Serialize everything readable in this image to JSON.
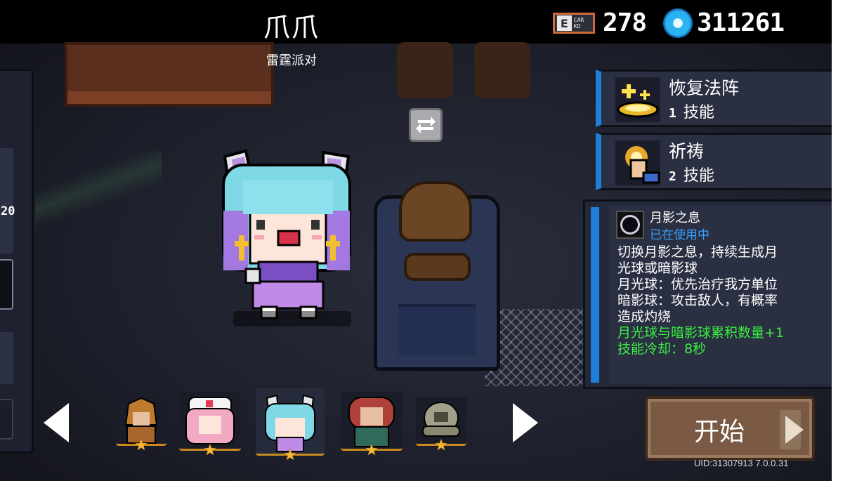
{
  "hero": {
    "name": "爪爪",
    "skin": "雷霆派对"
  },
  "currency": {
    "ecard_icon": "e-card-icon",
    "ecard_small_text": "CAR KD",
    "ecard_count": "278",
    "gem_icon": "blue-gem-icon",
    "gem_count": "311261"
  },
  "left_panel": {
    "partial_value": "20"
  },
  "skills": [
    {
      "icon": "golden-healing-circle-icon",
      "name": "恢复法阵",
      "level": "1",
      "level_label": "技能"
    },
    {
      "icon": "praying-hands-icon",
      "name": "祈祷",
      "level": "2",
      "level_label": "技能"
    }
  ],
  "weapon": {
    "icon": "dark-moon-orb-icon",
    "name": "月影之息",
    "status": "已在使用中",
    "description_lines": [
      "切换月影之息，持续生成月",
      "光球或暗影球",
      "月光球：优先治疗我方单位",
      "暗影球：攻击敌人，有概率",
      "造成灼烧"
    ],
    "bonus_lines": [
      "月光球与暗影球累积数量+1",
      "技能冷却：8秒"
    ]
  },
  "character_selector": {
    "prev_icon": "arrow-left-icon",
    "next_icon": "arrow-right-icon",
    "characters": [
      {
        "id": "char-1",
        "icon": "feathered-priest-portrait",
        "star": "★"
      },
      {
        "id": "char-2",
        "icon": "pink-nurse-portrait",
        "star": "★"
      },
      {
        "id": "char-3",
        "icon": "cyan-cat-girl-portrait",
        "star": "★",
        "selected": true
      },
      {
        "id": "char-4",
        "icon": "red-haired-warrior-portrait",
        "star": "★"
      },
      {
        "id": "char-5",
        "icon": "hooded-monk-portrait",
        "star": "★"
      }
    ]
  },
  "start_button": {
    "label": "开始"
  },
  "footer": {
    "uid": "UID:31307913 7.0.0.31"
  }
}
